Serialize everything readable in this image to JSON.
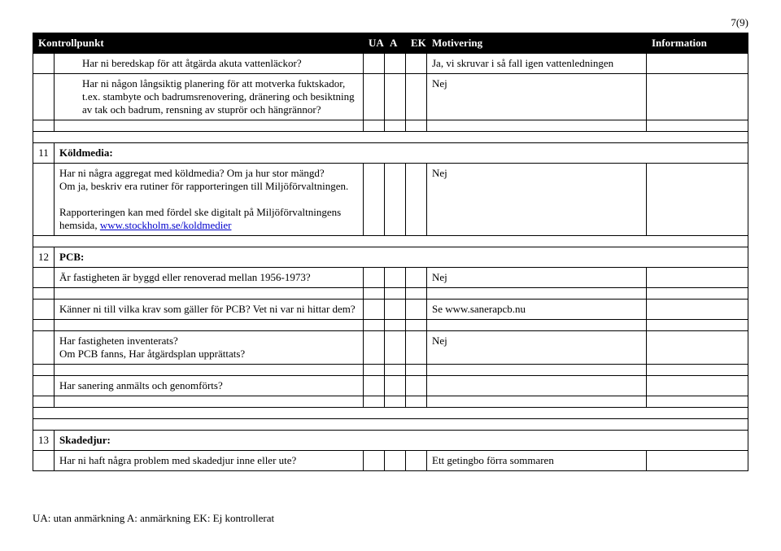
{
  "page_number": "7(9)",
  "header": {
    "kontrollpunkt": "Kontrollpunkt",
    "ua": "UA",
    "a": "A",
    "ek": "EK",
    "motivering": "Motivering",
    "information": "Information"
  },
  "rows": {
    "r1": {
      "q": "Har ni beredskap för att åtgärda akuta vattenläckor?",
      "m": "Ja, vi skruvar i så fall igen vattenledningen"
    },
    "r2": {
      "q": "Har ni någon långsiktig planering för att motverka fuktskador, t.ex. stambyte och badrumsrenovering, dränering och besiktning av tak och badrum, rensning av stuprör och hängrännor?",
      "m": "Nej"
    },
    "s11": {
      "num": "11",
      "title": "Köldmedia:"
    },
    "r11a": {
      "q1": "Har ni några aggregat med köldmedia? Om ja hur stor mängd?",
      "q2": "Om ja, beskriv era rutiner för rapporteringen till Miljöförvaltningen.",
      "q3": "Rapporteringen kan med fördel ske digitalt på Miljöförvaltningens hemsida, ",
      "link": "www.stockholm.se/koldmedier",
      "m": "Nej"
    },
    "s12": {
      "num": "12",
      "title": "PCB:"
    },
    "r12a": {
      "q": "Är fastigheten är byggd eller renoverad mellan 1956-1973?",
      "m": "Nej"
    },
    "r12b": {
      "q": "Känner ni till vilka krav som gäller för PCB? Vet ni var ni hittar dem?",
      "m": "Se www.sanerapcb.nu"
    },
    "r12c": {
      "q1": "Har fastigheten inventerats?",
      "q2": "Om PCB fanns, Har åtgärdsplan upprättats?",
      "m": "Nej"
    },
    "r12d": {
      "q": "Har sanering anmälts och genomförts?"
    },
    "s13": {
      "num": "13",
      "title": "Skadedjur:"
    },
    "r13a": {
      "q": "Har ni haft några problem med skadedjur inne eller ute?",
      "m": "Ett getingbo förra sommaren"
    }
  },
  "footer": {
    "text": "UA: utan anmärkning   A: anmärkning   EK: Ej kontrollerat"
  }
}
